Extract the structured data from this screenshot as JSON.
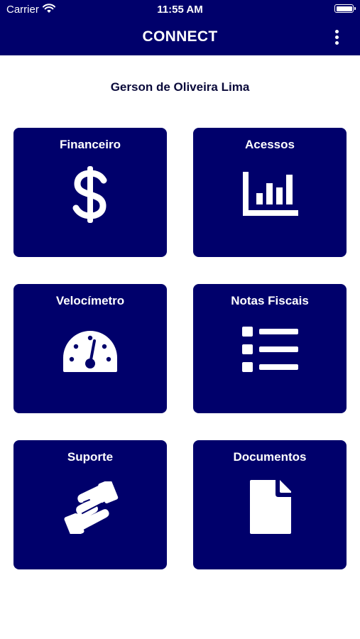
{
  "status_bar": {
    "carrier": "Carrier",
    "time": "11:55 AM"
  },
  "header": {
    "title": "CONNECT"
  },
  "user": {
    "name": "Gerson de Oliveira Lima"
  },
  "tiles": [
    {
      "label": "Financeiro",
      "icon": "dollar-icon"
    },
    {
      "label": "Acessos",
      "icon": "bar-chart-icon"
    },
    {
      "label": "Velocímetro",
      "icon": "speedometer-icon"
    },
    {
      "label": "Notas Fiscais",
      "icon": "list-icon"
    },
    {
      "label": "Suporte",
      "icon": "handshake-icon"
    },
    {
      "label": "Documentos",
      "icon": "document-icon"
    }
  ],
  "colors": {
    "primary": "#00006b",
    "text_dark": "#0a0a3a",
    "background": "#ffffff"
  }
}
